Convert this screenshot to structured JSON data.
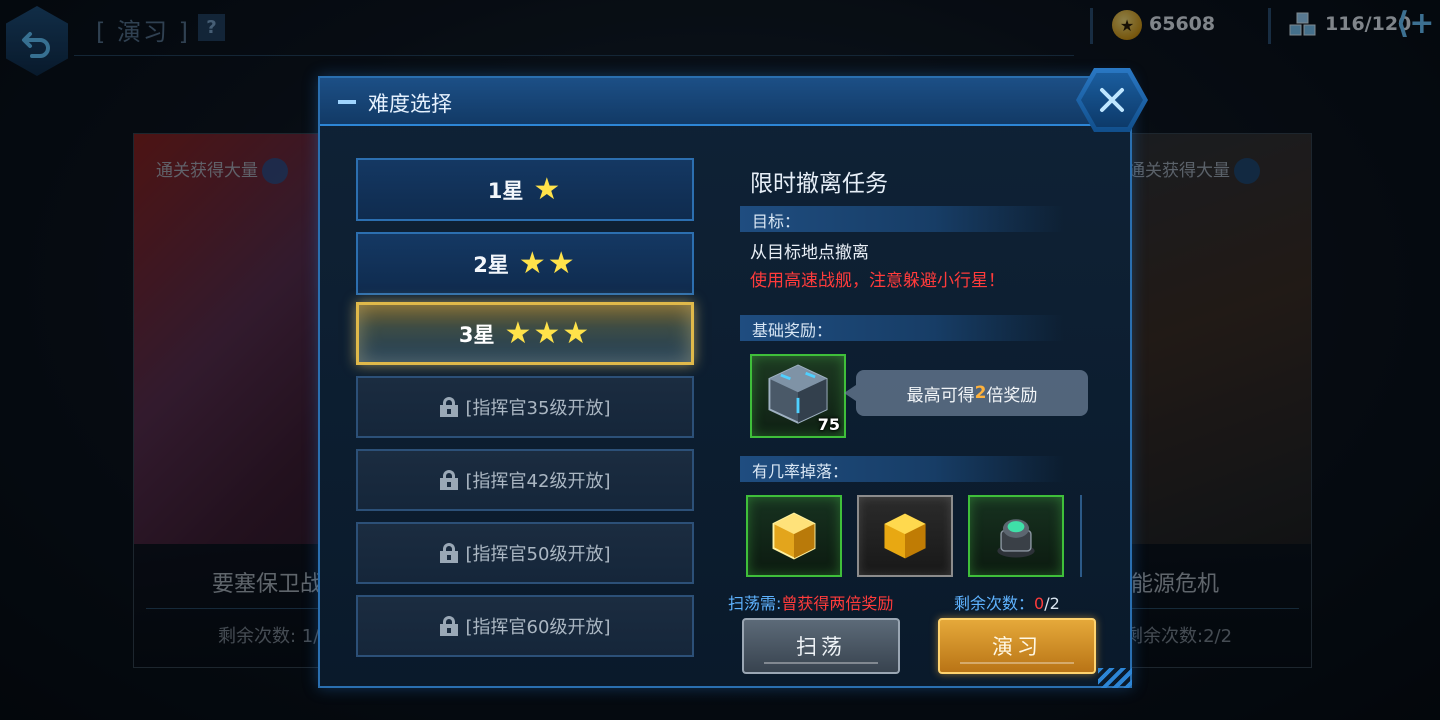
{
  "screen": {
    "title": "[ 演习 ]",
    "help_label": "?"
  },
  "resources": {
    "coins": "65608",
    "energy": "116/120",
    "add_label": "+"
  },
  "background_cards": [
    {
      "tag": "通关获得大量",
      "name": "要塞保卫战",
      "remaining": "剩余次数: 1/"
    },
    {
      "tag": "通关获得大量",
      "name": "能源危机",
      "remaining": "剩余次数:2/2"
    }
  ],
  "dialog": {
    "title": "难度选择",
    "difficulties": [
      {
        "label": "1星",
        "stars": "★",
        "state": "normal"
      },
      {
        "label": "2星",
        "stars": "★★",
        "state": "normal"
      },
      {
        "label": "3星",
        "stars": "★★★",
        "state": "selected"
      },
      {
        "label": "[指挥官35级开放]",
        "state": "locked"
      },
      {
        "label": "[指挥官42级开放]",
        "state": "locked"
      },
      {
        "label": "[指挥官50级开放]",
        "state": "locked"
      },
      {
        "label": "[指挥官60级开放]",
        "state": "locked"
      }
    ],
    "mission": {
      "title": "限时撤离任务",
      "goal_header": "目标：",
      "goal": "从目标地点撤离",
      "warning": "使用高速战舰，注意躲避小行星！",
      "reward_header": "基础奖励：",
      "reward_count": "75",
      "tooltip_prefix": "最高可得",
      "tooltip_mult": "2",
      "tooltip_suffix": "倍奖励",
      "drops_header": "有几率掉落：",
      "sweep_req_label": "扫荡需:",
      "sweep_req_value": "曾获得两倍奖励",
      "remain_label": "剩余次数：",
      "remain_current": "0",
      "remain_total": "/2"
    },
    "buttons": {
      "sweep": "扫荡",
      "drill": "演习"
    }
  },
  "colors": {
    "accent_blue": "#2d86d6",
    "star_yellow": "#ffe24a",
    "warning_red": "#ff3b3b",
    "highlight_orange": "#ffb23c",
    "drill_gold": "#e5a93a"
  }
}
